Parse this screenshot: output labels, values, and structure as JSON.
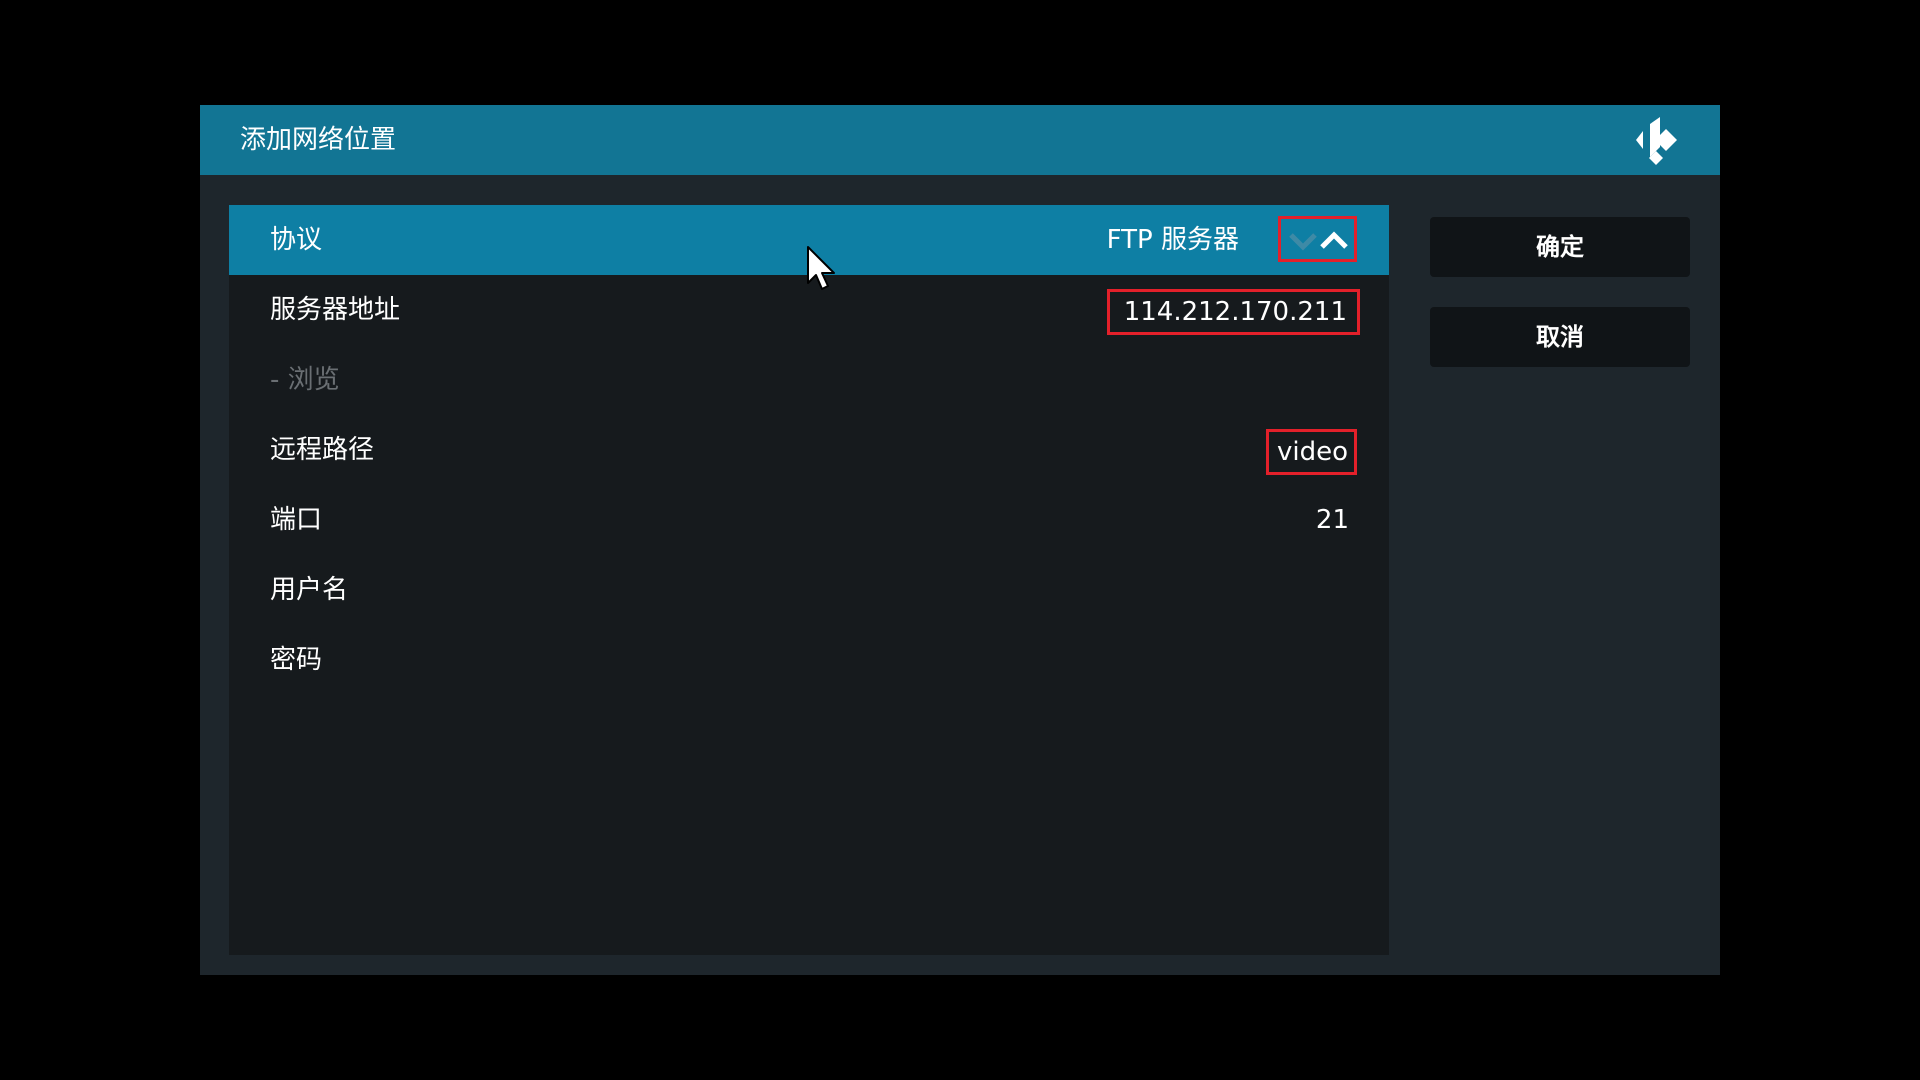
{
  "dialog": {
    "title": "添加网络位置",
    "logo_icon": "kodi-logo-icon"
  },
  "settings": [
    {
      "label": "协议",
      "value": "FTP 服务器",
      "selected": true,
      "control": "spinner"
    },
    {
      "label": "服务器地址",
      "value": "114.212.170.211"
    },
    {
      "label": "- 浏览",
      "disabled": true
    },
    {
      "label": "远程路径",
      "value": "video"
    },
    {
      "label": "端口",
      "value": "21"
    },
    {
      "label": "用户名",
      "value": ""
    },
    {
      "label": "密码",
      "value": ""
    }
  ],
  "buttons": {
    "ok_label": "确定",
    "cancel_label": "取消"
  },
  "colors": {
    "titlebar": "#127594",
    "selected_row": "#0e7fa4",
    "highlight_box": "#e3202a",
    "panel": "#161a1d",
    "dialog": "#1e262c"
  }
}
